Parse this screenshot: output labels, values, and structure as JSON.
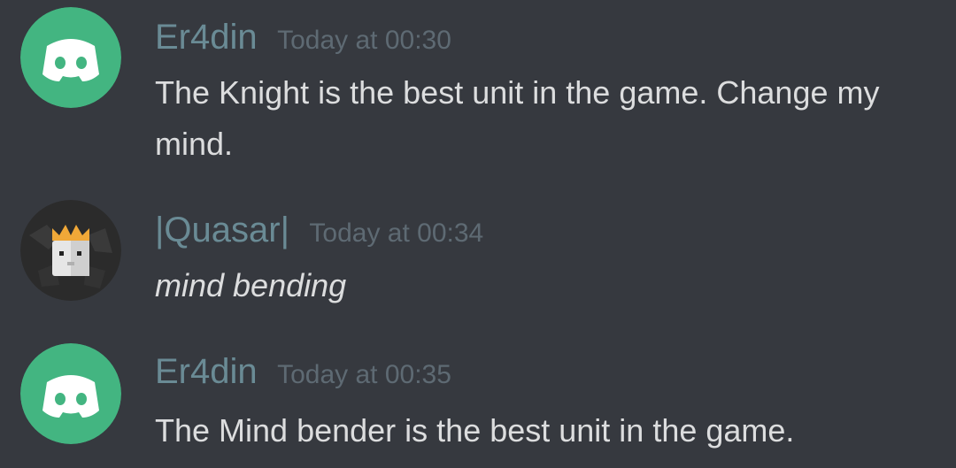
{
  "messages": [
    {
      "username": "Er4din",
      "timestamp": "Today at 00:30",
      "text": "The Knight is the best unit in the game. Change my mind.",
      "avatar_icon": "discord-default-avatar-icon",
      "avatar_color": "#43b581",
      "italic": false
    },
    {
      "username": "|Quasar|",
      "timestamp": "Today at 00:34",
      "text": "mind bending",
      "avatar_icon": "crowned-head-avatar-icon",
      "avatar_color": "#2b2b2b",
      "italic": true
    },
    {
      "username": "Er4din",
      "timestamp": "Today at 00:35",
      "text": "The Mind bender is the best unit in the game.",
      "avatar_icon": "discord-default-avatar-icon",
      "avatar_color": "#43b581",
      "italic": false
    }
  ],
  "colors": {
    "background": "#36393f",
    "username": "#6a8b95",
    "timestamp": "#5e6a73",
    "message_text": "#dcddde",
    "crown": "#f0a838"
  }
}
